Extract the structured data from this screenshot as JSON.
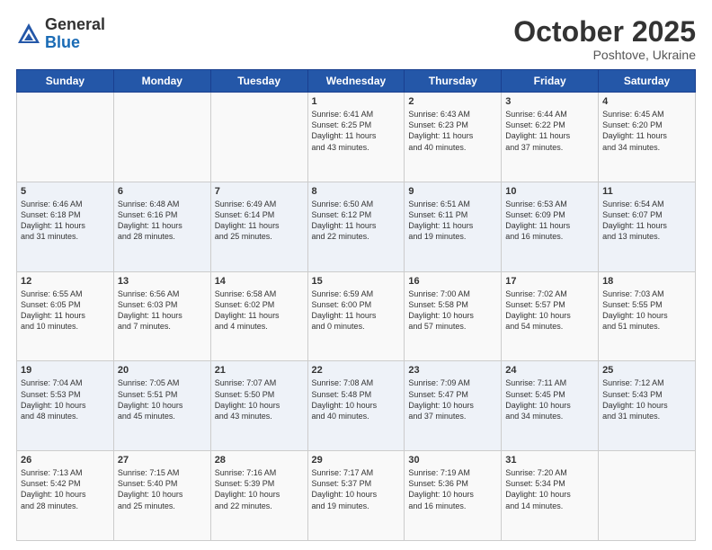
{
  "header": {
    "logo_general": "General",
    "logo_blue": "Blue",
    "month": "October 2025",
    "location": "Poshtove, Ukraine"
  },
  "weekdays": [
    "Sunday",
    "Monday",
    "Tuesday",
    "Wednesday",
    "Thursday",
    "Friday",
    "Saturday"
  ],
  "weeks": [
    [
      {
        "day": "",
        "info": ""
      },
      {
        "day": "",
        "info": ""
      },
      {
        "day": "",
        "info": ""
      },
      {
        "day": "1",
        "info": "Sunrise: 6:41 AM\nSunset: 6:25 PM\nDaylight: 11 hours\nand 43 minutes."
      },
      {
        "day": "2",
        "info": "Sunrise: 6:43 AM\nSunset: 6:23 PM\nDaylight: 11 hours\nand 40 minutes."
      },
      {
        "day": "3",
        "info": "Sunrise: 6:44 AM\nSunset: 6:22 PM\nDaylight: 11 hours\nand 37 minutes."
      },
      {
        "day": "4",
        "info": "Sunrise: 6:45 AM\nSunset: 6:20 PM\nDaylight: 11 hours\nand 34 minutes."
      }
    ],
    [
      {
        "day": "5",
        "info": "Sunrise: 6:46 AM\nSunset: 6:18 PM\nDaylight: 11 hours\nand 31 minutes."
      },
      {
        "day": "6",
        "info": "Sunrise: 6:48 AM\nSunset: 6:16 PM\nDaylight: 11 hours\nand 28 minutes."
      },
      {
        "day": "7",
        "info": "Sunrise: 6:49 AM\nSunset: 6:14 PM\nDaylight: 11 hours\nand 25 minutes."
      },
      {
        "day": "8",
        "info": "Sunrise: 6:50 AM\nSunset: 6:12 PM\nDaylight: 11 hours\nand 22 minutes."
      },
      {
        "day": "9",
        "info": "Sunrise: 6:51 AM\nSunset: 6:11 PM\nDaylight: 11 hours\nand 19 minutes."
      },
      {
        "day": "10",
        "info": "Sunrise: 6:53 AM\nSunset: 6:09 PM\nDaylight: 11 hours\nand 16 minutes."
      },
      {
        "day": "11",
        "info": "Sunrise: 6:54 AM\nSunset: 6:07 PM\nDaylight: 11 hours\nand 13 minutes."
      }
    ],
    [
      {
        "day": "12",
        "info": "Sunrise: 6:55 AM\nSunset: 6:05 PM\nDaylight: 11 hours\nand 10 minutes."
      },
      {
        "day": "13",
        "info": "Sunrise: 6:56 AM\nSunset: 6:03 PM\nDaylight: 11 hours\nand 7 minutes."
      },
      {
        "day": "14",
        "info": "Sunrise: 6:58 AM\nSunset: 6:02 PM\nDaylight: 11 hours\nand 4 minutes."
      },
      {
        "day": "15",
        "info": "Sunrise: 6:59 AM\nSunset: 6:00 PM\nDaylight: 11 hours\nand 0 minutes."
      },
      {
        "day": "16",
        "info": "Sunrise: 7:00 AM\nSunset: 5:58 PM\nDaylight: 10 hours\nand 57 minutes."
      },
      {
        "day": "17",
        "info": "Sunrise: 7:02 AM\nSunset: 5:57 PM\nDaylight: 10 hours\nand 54 minutes."
      },
      {
        "day": "18",
        "info": "Sunrise: 7:03 AM\nSunset: 5:55 PM\nDaylight: 10 hours\nand 51 minutes."
      }
    ],
    [
      {
        "day": "19",
        "info": "Sunrise: 7:04 AM\nSunset: 5:53 PM\nDaylight: 10 hours\nand 48 minutes."
      },
      {
        "day": "20",
        "info": "Sunrise: 7:05 AM\nSunset: 5:51 PM\nDaylight: 10 hours\nand 45 minutes."
      },
      {
        "day": "21",
        "info": "Sunrise: 7:07 AM\nSunset: 5:50 PM\nDaylight: 10 hours\nand 43 minutes."
      },
      {
        "day": "22",
        "info": "Sunrise: 7:08 AM\nSunset: 5:48 PM\nDaylight: 10 hours\nand 40 minutes."
      },
      {
        "day": "23",
        "info": "Sunrise: 7:09 AM\nSunset: 5:47 PM\nDaylight: 10 hours\nand 37 minutes."
      },
      {
        "day": "24",
        "info": "Sunrise: 7:11 AM\nSunset: 5:45 PM\nDaylight: 10 hours\nand 34 minutes."
      },
      {
        "day": "25",
        "info": "Sunrise: 7:12 AM\nSunset: 5:43 PM\nDaylight: 10 hours\nand 31 minutes."
      }
    ],
    [
      {
        "day": "26",
        "info": "Sunrise: 7:13 AM\nSunset: 5:42 PM\nDaylight: 10 hours\nand 28 minutes."
      },
      {
        "day": "27",
        "info": "Sunrise: 7:15 AM\nSunset: 5:40 PM\nDaylight: 10 hours\nand 25 minutes."
      },
      {
        "day": "28",
        "info": "Sunrise: 7:16 AM\nSunset: 5:39 PM\nDaylight: 10 hours\nand 22 minutes."
      },
      {
        "day": "29",
        "info": "Sunrise: 7:17 AM\nSunset: 5:37 PM\nDaylight: 10 hours\nand 19 minutes."
      },
      {
        "day": "30",
        "info": "Sunrise: 7:19 AM\nSunset: 5:36 PM\nDaylight: 10 hours\nand 16 minutes."
      },
      {
        "day": "31",
        "info": "Sunrise: 7:20 AM\nSunset: 5:34 PM\nDaylight: 10 hours\nand 14 minutes."
      },
      {
        "day": "",
        "info": ""
      }
    ]
  ]
}
